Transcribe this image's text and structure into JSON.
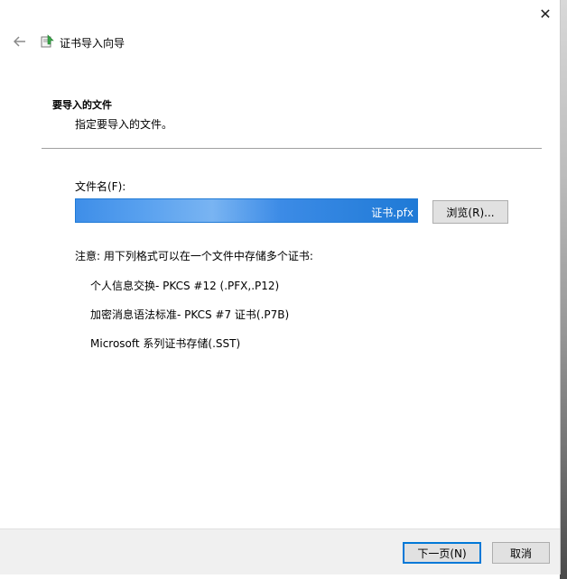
{
  "window": {
    "title": "证书导入向导",
    "close_label": "✕"
  },
  "page": {
    "heading": "要导入的文件",
    "subheading": "指定要导入的文件。"
  },
  "file": {
    "label": "文件名(F):",
    "value": "证书.pfx",
    "browse_label": "浏览(R)..."
  },
  "note": {
    "text": "注意: 用下列格式可以在一个文件中存储多个证书:",
    "formats": [
      "个人信息交换- PKCS #12 (.PFX,.P12)",
      "加密消息语法标准- PKCS #7 证书(.P7B)",
      "Microsoft 系列证书存储(.SST)"
    ]
  },
  "footer": {
    "next_label": "下一页(N)",
    "cancel_label": "取消"
  },
  "colors": {
    "accent": "#0078d7",
    "selection": "#1f7ad6"
  },
  "icons": [
    "back-arrow-icon",
    "certificate-wizard-icon",
    "close-icon"
  ]
}
